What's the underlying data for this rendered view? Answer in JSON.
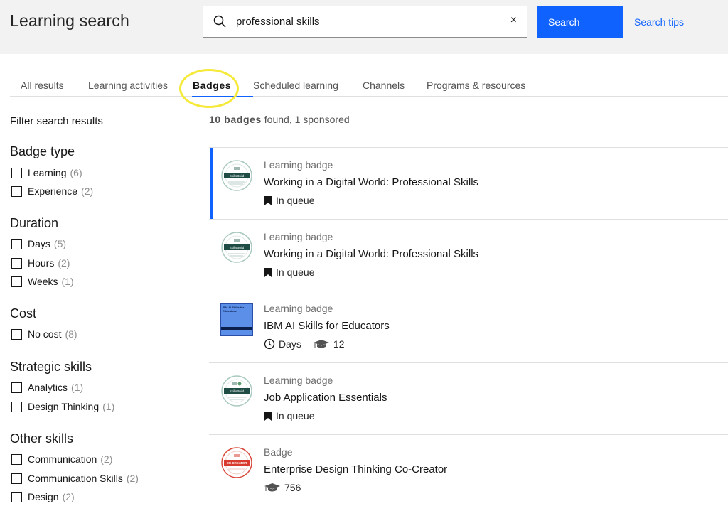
{
  "header": {
    "title": "Learning search",
    "search_value": "professional skills",
    "search_button": "Search",
    "search_tips": "Search tips",
    "clear_symbol": "×"
  },
  "tabs": [
    {
      "label": "All results",
      "active": false
    },
    {
      "label": "Learning activities",
      "active": false
    },
    {
      "label": "Badges",
      "active": true
    },
    {
      "label": "Scheduled learning",
      "active": false
    },
    {
      "label": "Channels",
      "active": false
    },
    {
      "label": "Programs & resources",
      "active": false
    }
  ],
  "sidebar": {
    "title": "Filter search results",
    "groups": [
      {
        "title": "Badge type",
        "options": [
          {
            "label": "Learning",
            "count": "(6)"
          },
          {
            "label": "Experience",
            "count": "(2)"
          }
        ]
      },
      {
        "title": "Duration",
        "options": [
          {
            "label": "Days",
            "count": "(5)"
          },
          {
            "label": "Hours",
            "count": "(2)"
          },
          {
            "label": "Weeks",
            "count": "(1)"
          }
        ]
      },
      {
        "title": "Cost",
        "options": [
          {
            "label": "No cost",
            "count": "(8)"
          }
        ]
      },
      {
        "title": "Strategic skills",
        "options": [
          {
            "label": "Analytics",
            "count": "(1)"
          },
          {
            "label": "Design Thinking",
            "count": "(1)"
          }
        ]
      },
      {
        "title": "Other skills",
        "options": [
          {
            "label": "Communication",
            "count": "(2)"
          },
          {
            "label": "Communication Skills",
            "count": "(2)"
          },
          {
            "label": "Design",
            "count": "(2)"
          }
        ]
      }
    ]
  },
  "results_summary": {
    "count_text": "10 badges",
    "rest_text": " found, 1 sponsored"
  },
  "results": [
    {
      "type": "Learning badge",
      "title": "Working in a Digital World: Professional Skills",
      "status": "In queue",
      "badge_label": "SkillsBuild",
      "icon": "bookmark-icon"
    },
    {
      "type": "Learning badge",
      "title": "Working in a Digital World: Professional Skills",
      "status": "In queue",
      "badge_label": "SkillsBuild",
      "icon": "bookmark-icon"
    },
    {
      "type": "Learning badge",
      "title": "IBM AI Skills for Educators",
      "duration": "Days",
      "learners": "12",
      "thumb_text": "IBM AI Skills for Educators"
    },
    {
      "type": "Learning badge",
      "title": "Job Application Essentials",
      "status": "In queue",
      "badge_label": "SkillsBuild",
      "icon": "bookmark-icon"
    },
    {
      "type": "Badge",
      "title": "Enterprise Design Thinking Co-Creator",
      "learners": "756",
      "badge_label": "CO-CREATOR"
    }
  ],
  "colors": {
    "accent": "#0f62fe",
    "highlight": "#f5e93a",
    "header_bg": "#f2f2f2"
  }
}
